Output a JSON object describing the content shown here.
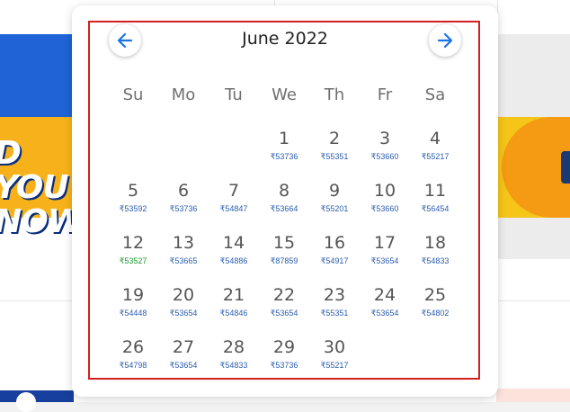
{
  "calendar": {
    "month_title": "June 2022",
    "prev_icon": "arrow-left-icon",
    "next_icon": "arrow-right-icon",
    "accent_color": "#1a73e8",
    "highlight_color": "#d41f1f",
    "cheapest_color": "#1a9a2e",
    "weekdays": [
      "Su",
      "Mo",
      "Tu",
      "We",
      "Th",
      "Fr",
      "Sa"
    ],
    "first_weekday_index": 3,
    "days": [
      {
        "day": "1",
        "price": "₹53736"
      },
      {
        "day": "2",
        "price": "₹55351"
      },
      {
        "day": "3",
        "price": "₹53660"
      },
      {
        "day": "4",
        "price": "₹55217"
      },
      {
        "day": "5",
        "price": "₹53592"
      },
      {
        "day": "6",
        "price": "₹53736"
      },
      {
        "day": "7",
        "price": "₹54847"
      },
      {
        "day": "8",
        "price": "₹53664"
      },
      {
        "day": "9",
        "price": "₹55201"
      },
      {
        "day": "10",
        "price": "₹53660"
      },
      {
        "day": "11",
        "price": "₹56454"
      },
      {
        "day": "12",
        "price": "₹53527",
        "cheapest": true
      },
      {
        "day": "13",
        "price": "₹53665"
      },
      {
        "day": "14",
        "price": "₹54886"
      },
      {
        "day": "15",
        "price": "₹87859"
      },
      {
        "day": "16",
        "price": "₹54917"
      },
      {
        "day": "17",
        "price": "₹53654"
      },
      {
        "day": "18",
        "price": "₹54833"
      },
      {
        "day": "19",
        "price": "₹54448"
      },
      {
        "day": "20",
        "price": "₹53654"
      },
      {
        "day": "21",
        "price": "₹54846"
      },
      {
        "day": "22",
        "price": "₹53654"
      },
      {
        "day": "23",
        "price": "₹55351"
      },
      {
        "day": "24",
        "price": "₹53654"
      },
      {
        "day": "25",
        "price": "₹54802"
      },
      {
        "day": "26",
        "price": "₹54798"
      },
      {
        "day": "27",
        "price": "₹53654"
      },
      {
        "day": "28",
        "price": "₹54833"
      },
      {
        "day": "29",
        "price": "₹53736"
      },
      {
        "day": "30",
        "price": "₹55217"
      }
    ]
  },
  "background": {
    "promo_text_line1": "D YOU",
    "promo_text_line2": "NOW"
  }
}
